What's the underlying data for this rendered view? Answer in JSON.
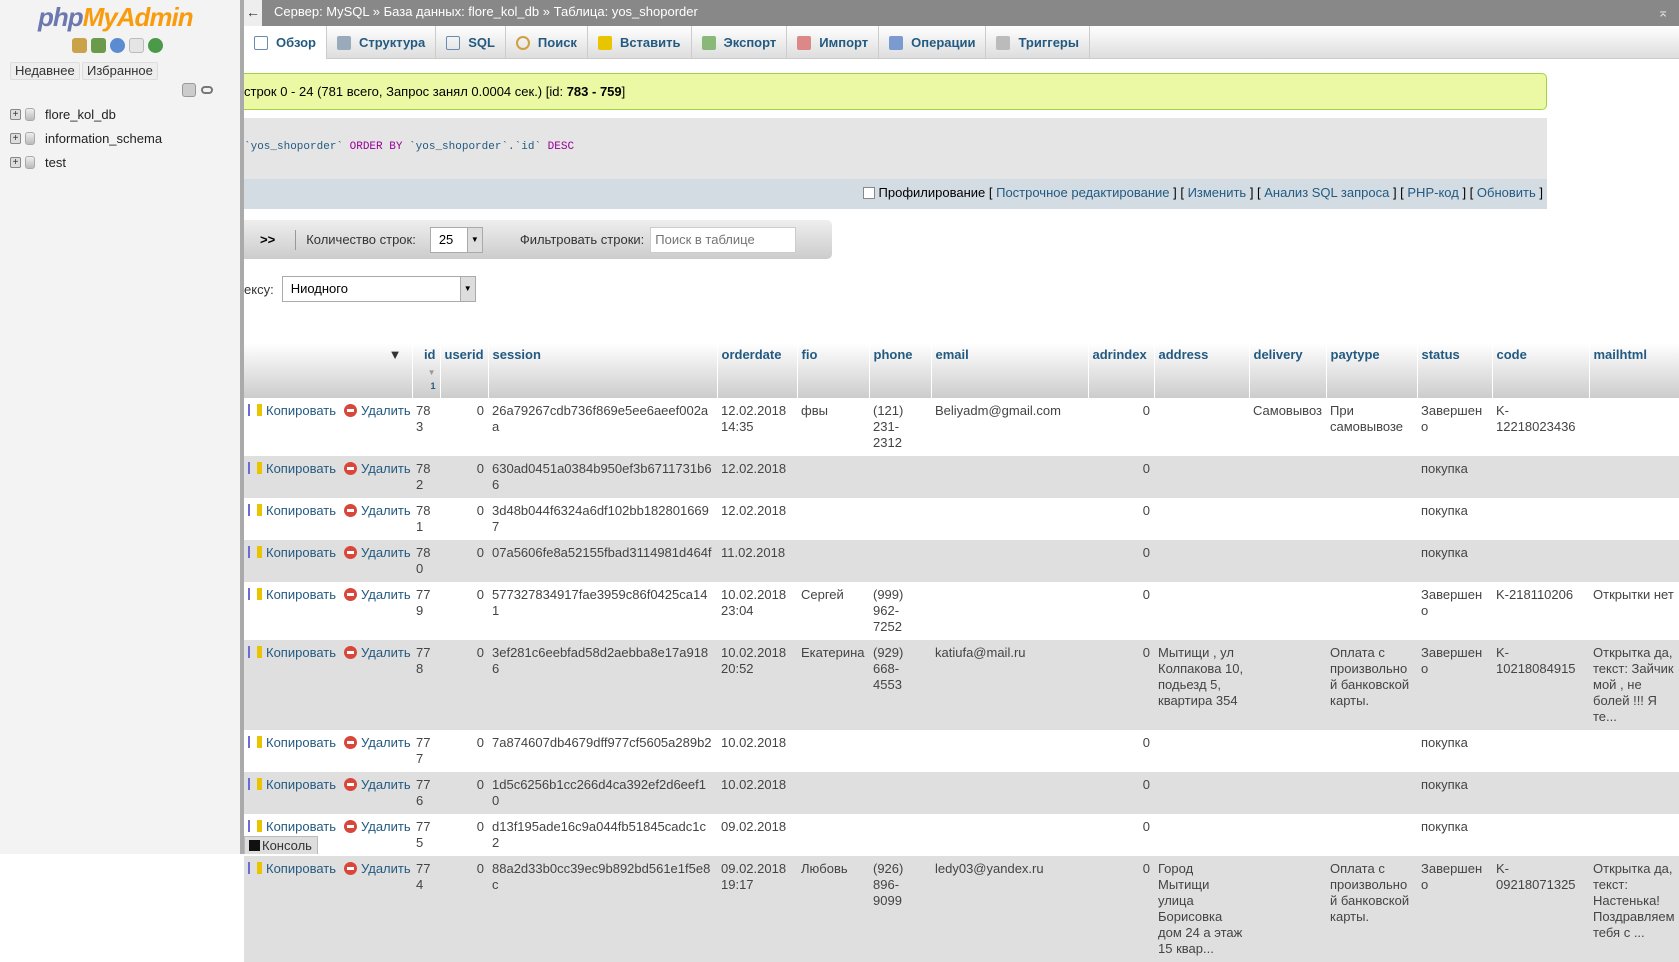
{
  "sidebar": {
    "logo_php": "php",
    "logo_my": "MyAdmin",
    "recent": "Недавнее",
    "favorites": "Избранное",
    "databases": [
      "flore_kol_db",
      "information_schema",
      "test"
    ]
  },
  "topbar": {
    "server": "Сервер: MySQL",
    "sep": "»",
    "database": "База данных: flore_kol_db",
    "table": "Таблица: yos_shoporder"
  },
  "tabs": [
    "Обзор",
    "Структура",
    "SQL",
    "Поиск",
    "Вставить",
    "Экспорт",
    "Импорт",
    "Операции",
    "Триггеры"
  ],
  "notice": {
    "prefix": "строк 0 - 24 (781 всего, Запрос занял 0.0004 сек.) [id: ",
    "range": "783 - 759",
    "suffix": "]"
  },
  "sql": {
    "part1": "`yos_shoporder` ",
    "kw1": "ORDER BY",
    "part2": " `yos_shoporder`.`id` ",
    "kw2": "DESC"
  },
  "sql_links": {
    "profiling": "Профилирование",
    "inline_edit": "Построчное редактирование",
    "edit": "Изменить",
    "analyze": "Анализ SQL запроса",
    "php": "PHP-код",
    "refresh": "Обновить"
  },
  "nav": {
    "next": ">>",
    "rows_label": "Количество строк:",
    "rows_value": "25",
    "filter_label": "Фильтровать строки:",
    "filter_placeholder": "Поиск в таблице"
  },
  "index": {
    "label": "ексу:",
    "value": "Ниодного"
  },
  "table": {
    "copy": "Копировать",
    "delete": "Удалить",
    "sort_num": "1",
    "columns": [
      "id",
      "userid",
      "session",
      "orderdate",
      "fio",
      "phone",
      "email",
      "adrindex",
      "address",
      "delivery",
      "paytype",
      "status",
      "code",
      "mailhtml"
    ],
    "rows": [
      [
        "783",
        "0",
        "26a79267cdb736f869e5ee6aeef002aa",
        "12.02.2018 14:35",
        "фвы",
        "(121) 231-2312",
        "Beliyadm@gmail.com",
        "0",
        "",
        "Самовывоз",
        "При самовывозе",
        "Завершено",
        "K-12218023436",
        ""
      ],
      [
        "782",
        "0",
        "630ad0451a0384b950ef3b6711731b66",
        "12.02.2018",
        "",
        "",
        "",
        "0",
        "",
        "",
        "",
        "покупка",
        "",
        ""
      ],
      [
        "781",
        "0",
        "3d48b044f6324a6df102bb1828016697",
        "12.02.2018",
        "",
        "",
        "",
        "0",
        "",
        "",
        "",
        "покупка",
        "",
        ""
      ],
      [
        "780",
        "0",
        "07a5606fe8a52155fbad3114981d464f",
        "11.02.2018",
        "",
        "",
        "",
        "0",
        "",
        "",
        "",
        "покупка",
        "",
        ""
      ],
      [
        "779",
        "0",
        "577327834917fae3959c86f0425ca141",
        "10.02.2018 23:04",
        "Сергей",
        "(999) 962-7252",
        "",
        "0",
        "",
        "",
        "",
        "Завершено",
        "K-218110206",
        "Открытки нет"
      ],
      [
        "778",
        "0",
        "3ef281c6eebfad58d2aebba8e17a9186",
        "10.02.2018 20:52",
        "Екатерина",
        "(929) 668-4553",
        "katiufa@mail.ru",
        "0",
        "Мытищи , ул Колпакова 10, подьезд 5, квартира 354",
        "",
        "Оплата с произвольной банковской карты.",
        "Завершено",
        "K-10218084915",
        "Открытка да, текст: Зайчик мой , не болей !!! Я те..."
      ],
      [
        "777",
        "0",
        "7a874607db4679dff977cf5605a289b2",
        "10.02.2018",
        "",
        "",
        "",
        "0",
        "",
        "",
        "",
        "покупка",
        "",
        ""
      ],
      [
        "776",
        "0",
        "1d5c6256b1cc266d4ca392ef2d6eef10",
        "10.02.2018",
        "",
        "",
        "",
        "0",
        "",
        "",
        "",
        "покупка",
        "",
        ""
      ],
      [
        "775",
        "0",
        "d13f195ade16c9a044fb51845cadc1c2",
        "09.02.2018",
        "",
        "",
        "",
        "0",
        "",
        "",
        "",
        "покупка",
        "",
        ""
      ],
      [
        "774",
        "0",
        "88a2d33b0cc39ec9b892bd561e1f5e8c",
        "09.02.2018 19:17",
        "Любовь",
        "(926) 896-9099",
        "ledy03@yandex.ru",
        "0",
        "Город Мытищи улица Борисовка дом 24 а этаж 15 квар...",
        "",
        "Оплата с произвольной банковской карты.",
        "Завершено",
        "K-09218071325",
        "Открытка да, текст: Настенька! Поздравляем тебя с ..."
      ]
    ]
  },
  "console": "Консоль"
}
